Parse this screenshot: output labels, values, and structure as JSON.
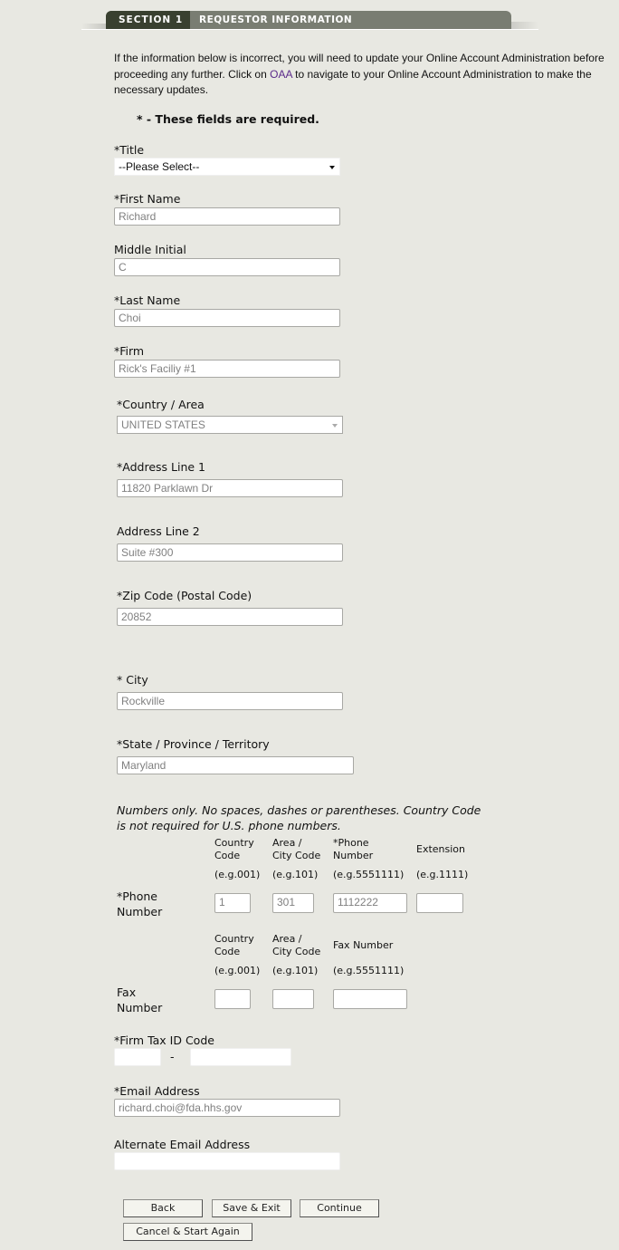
{
  "section": {
    "number": "SECTION 1",
    "title": "REQUESTOR INFORMATION"
  },
  "intro": {
    "text_before_link": "If the information below is incorrect, you will need to update your Online Account Administration before proceeding any further. Click on ",
    "link": "OAA",
    "text_after_link": " to navigate to your Online Account Administration to make the necessary updates.",
    "required_note": "* - These fields are required."
  },
  "colors": {
    "header_dark": "#394030",
    "header_light": "#797d72",
    "background": "#e8e8e2",
    "link": "#5a2a8a"
  },
  "fields": {
    "title": {
      "label": "*Title",
      "value": "--Please Select--"
    },
    "first_name": {
      "label": "*First Name",
      "value": "Richard"
    },
    "middle_initial": {
      "label": "Middle Initial",
      "value": "C"
    },
    "last_name": {
      "label": "*Last Name",
      "value": "Choi"
    },
    "firm": {
      "label": "*Firm",
      "value": "Rick's Faciliy #1"
    },
    "country": {
      "label": "*Country / Area",
      "value": "UNITED STATES"
    },
    "address1": {
      "label": "*Address Line 1",
      "value": "11820 Parklawn Dr"
    },
    "address2": {
      "label": "Address Line 2",
      "value": "Suite #300"
    },
    "zip": {
      "label": "*Zip Code (Postal Code)",
      "value": "20852"
    },
    "city": {
      "label": "* City",
      "value": "Rockville"
    },
    "state": {
      "label": "*State / Province / Territory",
      "value": "Maryland"
    },
    "tax_id": {
      "label": "*Firm Tax ID Code",
      "separator": "-",
      "value1": "",
      "value2": ""
    },
    "email": {
      "label": "*Email Address",
      "value": "richard.choi@fda.hhs.gov"
    },
    "alt_email": {
      "label": "Alternate Email Address",
      "value": ""
    }
  },
  "phone_hint": "Numbers only. No spaces, dashes or parentheses. Country Code is not required for U.S. phone numbers.",
  "phone": {
    "label_line1": "*Phone",
    "label_line2": "Number",
    "columns": [
      {
        "h1": "Country",
        "h2": "Code",
        "example": "(e.g.001)",
        "value": "1"
      },
      {
        "h1": "Area /",
        "h2": "City Code",
        "example": "(e.g.101)",
        "value": "301"
      },
      {
        "h1": "*Phone",
        "h2": "Number",
        "example": "(e.g.5551111)",
        "value": "1112222"
      },
      {
        "h1": "Extension",
        "h2": "",
        "example": "(e.g.1111)",
        "value": ""
      }
    ]
  },
  "fax": {
    "label_line1": "Fax",
    "label_line2": "Number",
    "columns": [
      {
        "h1": "Country",
        "h2": "Code",
        "example": "(e.g.001)",
        "value": ""
      },
      {
        "h1": "Area /",
        "h2": "City Code",
        "example": "(e.g.101)",
        "value": ""
      },
      {
        "h1": "Fax Number",
        "h2": "",
        "example": "(e.g.5551111)",
        "value": ""
      }
    ]
  },
  "buttons": {
    "back": "Back",
    "save_exit": "Save & Exit",
    "continue": "Continue",
    "cancel": "Cancel & Start Again"
  }
}
